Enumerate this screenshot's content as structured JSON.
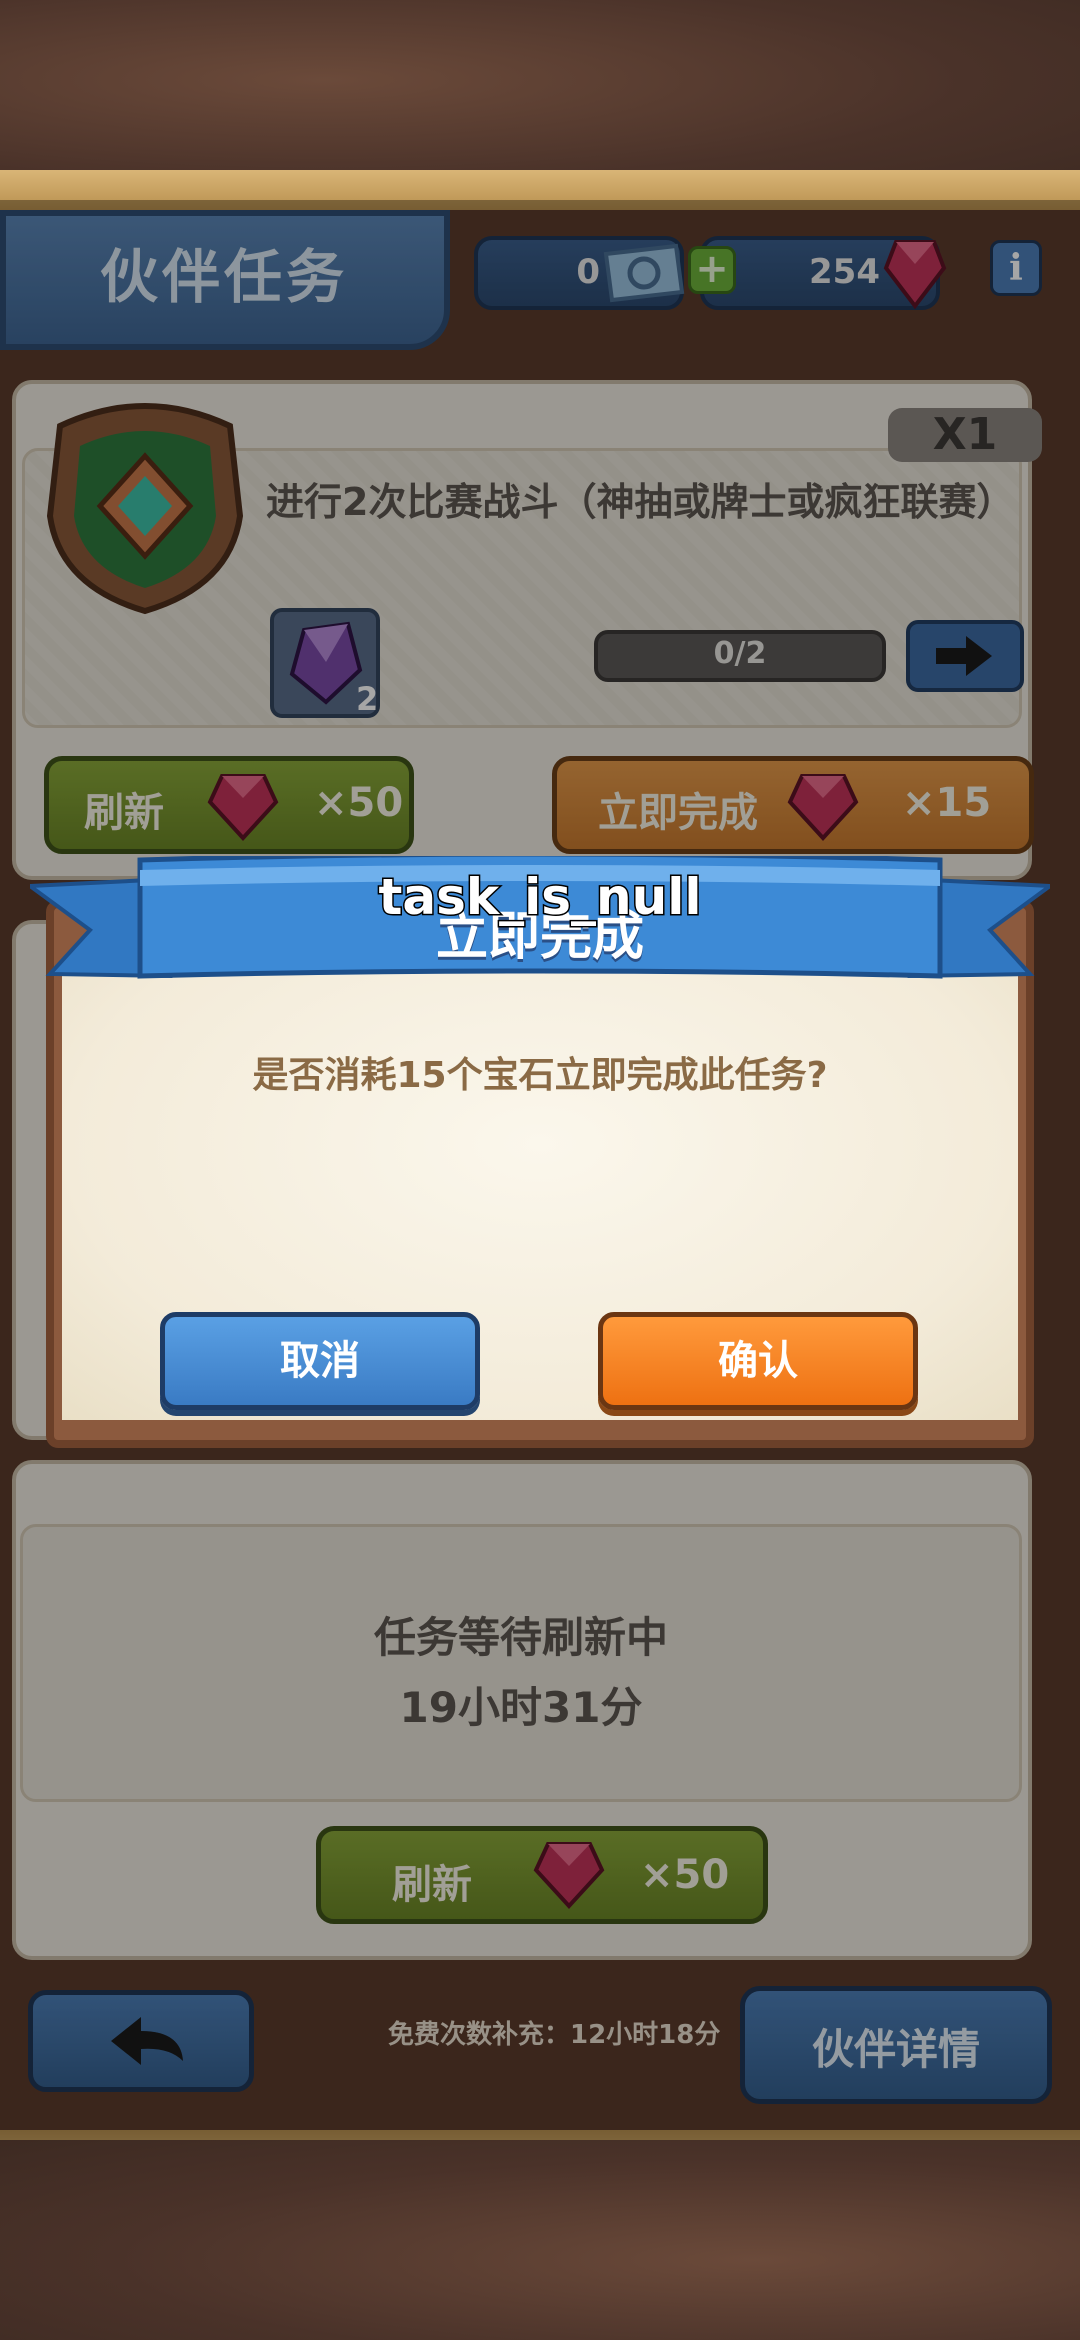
{
  "header": {
    "title": "伙伴任务",
    "ticket_count": "0",
    "gem_count": "254",
    "plus_label": "+",
    "info_label": "i"
  },
  "task1": {
    "multiplier": "X1",
    "description": "进行2次比赛战斗（神抽或牌士或疯狂联赛）",
    "reward_count": "2",
    "progress": "0/2",
    "progress_fraction": 0,
    "refresh_label": "刷新",
    "refresh_cost": "×50",
    "complete_label": "立即完成",
    "complete_cost": "×15"
  },
  "task3": {
    "waiting_text": "任务等待刷新中",
    "timer": "19小时31分",
    "refresh_label": "刷新",
    "refresh_cost": "×50"
  },
  "footer": {
    "free_refill": "免费次数补充：12小时18分",
    "partner_detail": "伙伴详情"
  },
  "dialog": {
    "title": "立即完成",
    "debug_overlay": "task_is_null",
    "message": "是否消耗15个宝石立即完成此任务?",
    "cancel_label": "取消",
    "confirm_label": "确认"
  },
  "colors": {
    "gem": "#c2345a",
    "refresh_green": "#7a9630",
    "complete_orange": "#d6883a",
    "cancel_blue": "#3a7bc4",
    "confirm_orange": "#ee7112",
    "ribbon_blue": "#3d8ad6"
  },
  "icons": [
    "ticket-icon",
    "gem-icon",
    "info-icon",
    "shield-emblem-icon",
    "crystal-icon",
    "arrow-right-icon",
    "back-arrow-icon"
  ]
}
